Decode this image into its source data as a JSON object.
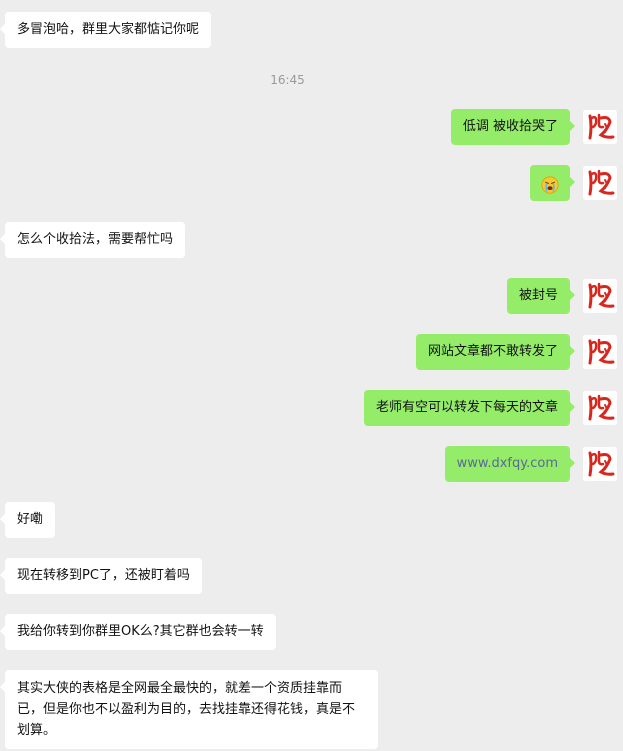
{
  "colors": {
    "background": "#ededed",
    "incoming_bubble": "#ffffff",
    "outgoing_bubble": "#95ec69",
    "link": "#576b95",
    "timestamp": "#9a9a9a"
  },
  "avatar_icon": "calligraphy-red-character-avatar",
  "messages": [
    {
      "side": "left",
      "text": "多冒泡哈，群里大家都惦记你呢"
    },
    {
      "type": "time",
      "text": "16:45"
    },
    {
      "side": "right",
      "text": "低调 被收拾哭了"
    },
    {
      "side": "right",
      "emoji": "crying-face-emoji"
    },
    {
      "side": "left",
      "text": "怎么个收拾法，需要帮忙吗"
    },
    {
      "side": "right",
      "text": "被封号"
    },
    {
      "side": "right",
      "text": "网站文章都不敢转发了"
    },
    {
      "side": "right",
      "text": "老师有空可以转发下每天的文章"
    },
    {
      "side": "right",
      "text": "www.dxfqy.com",
      "is_link": true
    },
    {
      "side": "left",
      "text": "好嘞"
    },
    {
      "side": "left",
      "text": "现在转移到PC了，还被盯着吗"
    },
    {
      "side": "left",
      "text": "我给你转到你群里OK么?其它群也会转一转"
    },
    {
      "side": "left",
      "text": "其实大侠的表格是全网最全最快的，就差一个资质挂靠而已，但是你也不以盈利为目的，去找挂靠还得花钱，真是不划算。"
    }
  ]
}
